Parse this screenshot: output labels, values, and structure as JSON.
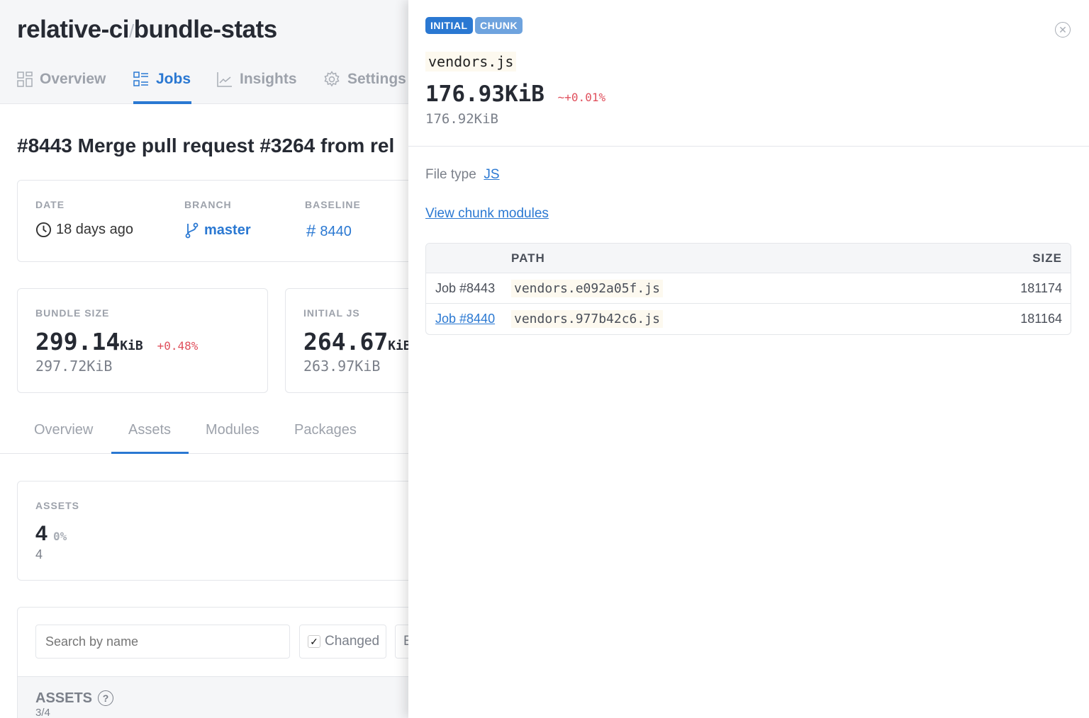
{
  "header": {
    "org": "relative-ci",
    "separator": "/",
    "repo": "bundle-stats"
  },
  "nav": [
    {
      "label": "Overview",
      "icon": "dashboard-icon"
    },
    {
      "label": "Jobs",
      "icon": "list-icon",
      "active": true
    },
    {
      "label": "Insights",
      "icon": "chart-icon"
    },
    {
      "label": "Settings",
      "icon": "gear-icon"
    }
  ],
  "job_title": "#8443 Merge pull request #3264 from rel",
  "meta": {
    "date_label": "DATE",
    "date": "18 days ago",
    "branch_label": "BRANCH",
    "branch": "master",
    "baseline_label": "BASELINE",
    "baseline": "8440"
  },
  "metrics": [
    {
      "label": "BUNDLE SIZE",
      "value": "299.14",
      "unit": "KiB",
      "delta": "+0.48%",
      "baseline": "297.72KiB"
    },
    {
      "label": "INITIAL JS",
      "value": "264.67",
      "unit": "KiB",
      "baseline": "263.97KiB"
    }
  ],
  "tabs": [
    "Overview",
    "Assets",
    "Modules",
    "Packages"
  ],
  "active_tab": "Assets",
  "assets_card": {
    "label": "ASSETS",
    "value": "4",
    "delta": "0%",
    "baseline": "4"
  },
  "filters": {
    "search_placeholder": "Search by name",
    "changed_label": "Changed",
    "changed_checked": true,
    "next_partial": "E"
  },
  "assets_table": {
    "title": "ASSETS",
    "count": "3/4"
  },
  "panel": {
    "badges": [
      "INITIAL",
      "CHUNK"
    ],
    "file_name": "vendors.js",
    "size": "176.93KiB",
    "delta": "~+0.01%",
    "baseline_size": "176.92KiB",
    "file_type_label": "File type",
    "file_type": "JS",
    "view_modules": "View chunk modules",
    "table": {
      "headers": [
        "",
        "PATH",
        "SIZE"
      ],
      "rows": [
        {
          "job": "Job #8443",
          "path": "vendors.e092a05f.js",
          "size": "181174",
          "link": false
        },
        {
          "job": "Job #8440",
          "path": "vendors.977b42c6.js",
          "size": "181164",
          "link": true
        }
      ]
    }
  },
  "colors": {
    "accent": "#2a78d2",
    "negative": "#e0505d",
    "badge_initial": "#2a78d2",
    "badge_chunk": "#6ea3de"
  }
}
